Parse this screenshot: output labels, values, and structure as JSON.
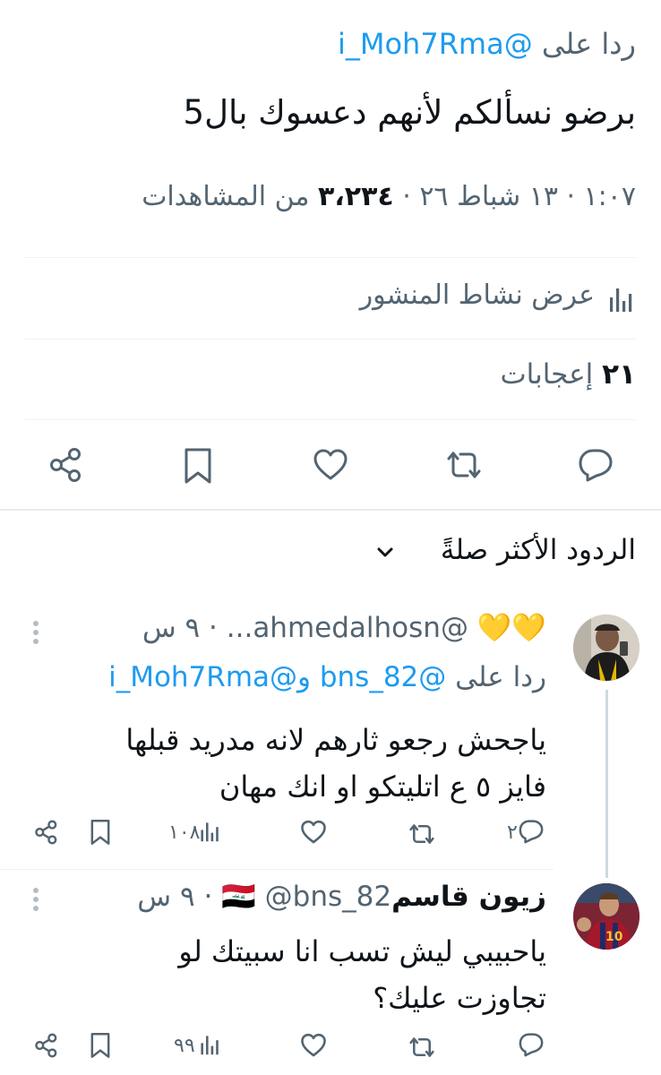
{
  "main_tweet": {
    "reply_prefix": "ردا على",
    "reply_to": "@i_Moh7Rma",
    "text": "برضو نسألكم لأنهم دعسوك بال5",
    "meta_time_date": "١:٠٧ · ١٣ شباط ٢٦ ·",
    "views_count": "٣،٢٣٤",
    "views_label": "من المشاهدات",
    "activity_label": "عرض نشاط المنشور",
    "likes_count": "٢١",
    "likes_label": "إعجابات"
  },
  "replies_sort": {
    "label": "الردود الأكثر صلةً"
  },
  "replies": [
    {
      "display_name_emoji": "💛💛",
      "handle": "@ahmedalhosn...",
      "time": "· ٩ س",
      "reply_prefix": "ردا على",
      "reply_to_1": "@bns_82",
      "reply_to_join": "و",
      "reply_to_2": "@i_Moh7Rma",
      "text_line1": "ياجحش رجعو ثارهم لانه مدريد قبلها",
      "text_line2": "فايز ٥ ع اتليتكو او انك مهان",
      "reply_count": "٢",
      "views_count": "١٠٨"
    },
    {
      "display_name": "زيون قاسم",
      "flag_emoji": "🇮🇶",
      "handle": "@bns_82",
      "time": "· ٩ س",
      "text_line1": "ياحبيبي ليش تسب انا سبيتك لو",
      "text_line2": "تجاوزت عليك؟",
      "reply_count": "",
      "views_count": "٩٩"
    }
  ],
  "colors": {
    "accent": "#1d9bf0",
    "secondary_text": "#536471",
    "divider": "#eff3f4",
    "heart_emoji": "#f5b800"
  }
}
